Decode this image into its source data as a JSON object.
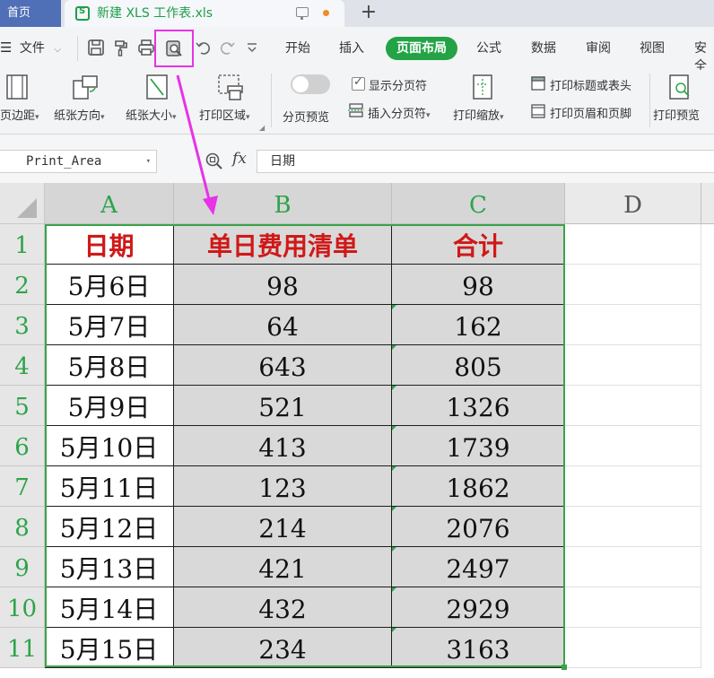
{
  "tabbar": {
    "home_tab": "首页",
    "doc_tab": "新建 XLS 工作表.xls",
    "new_tab_symbol": "+"
  },
  "menu": {
    "file_label": "文件",
    "tabs": [
      "开始",
      "插入",
      "页面布局",
      "公式",
      "数据",
      "审阅",
      "视图",
      "安全"
    ],
    "active_tab": "页面布局"
  },
  "ribbon": {
    "margins": "页边距",
    "orientation": "纸张方向",
    "size": "纸张大小",
    "print_area": "打印区域",
    "page_break_preview": "分页预览",
    "show_page_breaks": "显示分页符",
    "insert_page_break": "插入分页符",
    "print_scale": "打印缩放",
    "print_titles": "打印标题或表头",
    "print_header_footer": "打印页眉和页脚",
    "print_preview": "打印预览"
  },
  "formula_bar": {
    "name_box": "Print_Area",
    "fx_label": "fx",
    "formula": "日期"
  },
  "sheet": {
    "columns": [
      "A",
      "B",
      "C",
      "D"
    ],
    "rows": [
      "1",
      "2",
      "3",
      "4",
      "5",
      "6",
      "7",
      "8",
      "9",
      "10",
      "11"
    ],
    "headers": [
      "日期",
      "单日费用清单",
      "合计"
    ],
    "data": [
      [
        "5月6日",
        "98",
        "98"
      ],
      [
        "5月7日",
        "64",
        "162"
      ],
      [
        "5月8日",
        "643",
        "805"
      ],
      [
        "5月9日",
        "521",
        "1326"
      ],
      [
        "5月10日",
        "413",
        "1739"
      ],
      [
        "5月11日",
        "123",
        "1862"
      ],
      [
        "5月12日",
        "214",
        "2076"
      ],
      [
        "5月13日",
        "421",
        "2497"
      ],
      [
        "5月14日",
        "432",
        "2929"
      ],
      [
        "5月15日",
        "234",
        "3163"
      ]
    ]
  },
  "colors": {
    "accent_green": "#23a346",
    "highlight_magenta": "#e633e6",
    "header_red": "#d01818",
    "home_tab_blue": "#4f6fb6"
  }
}
